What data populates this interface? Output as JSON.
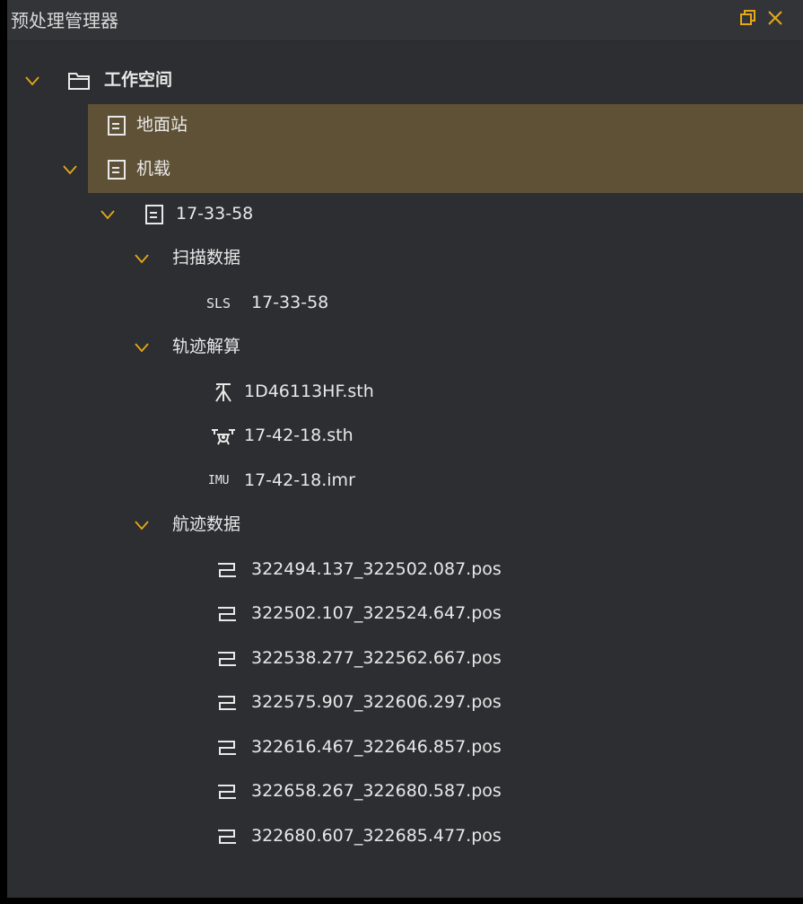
{
  "panel": {
    "title": "预处理管理器",
    "accent_color": "#e6a817",
    "selection_color": "#5f5136",
    "float_icon": "restore-window-icon",
    "close_icon": "close-icon"
  },
  "tree": {
    "root": {
      "label": "工作空间",
      "icon": "folder-icon",
      "expanded": true
    },
    "ground_station": {
      "label": "地面站",
      "icon": "document-icon",
      "selected": true
    },
    "airborne": {
      "label": "机载",
      "icon": "document-icon",
      "expanded": true,
      "selected": true
    },
    "session": {
      "label": "17-33-58",
      "icon": "document-icon",
      "expanded": true
    },
    "scan_data": {
      "label": "扫描数据",
      "expanded": true,
      "items": [
        {
          "icon_text": "SLS",
          "label": "17-33-58"
        }
      ]
    },
    "trajectory_solve": {
      "label": "轨迹解算",
      "expanded": true,
      "items": [
        {
          "icon": "base-station-icon",
          "label": "1D46113HF.sth"
        },
        {
          "icon": "drone-icon",
          "label": "17-42-18.sth"
        },
        {
          "icon_text": "IMU",
          "label": "17-42-18.imr"
        }
      ]
    },
    "flight_data": {
      "label": "航迹数据",
      "expanded": true,
      "items": [
        {
          "icon": "trajectory-icon",
          "label": "322494.137_322502.087.pos"
        },
        {
          "icon": "trajectory-icon",
          "label": "322502.107_322524.647.pos"
        },
        {
          "icon": "trajectory-icon",
          "label": "322538.277_322562.667.pos"
        },
        {
          "icon": "trajectory-icon",
          "label": "322575.907_322606.297.pos"
        },
        {
          "icon": "trajectory-icon",
          "label": "322616.467_322646.857.pos"
        },
        {
          "icon": "trajectory-icon",
          "label": "322658.267_322680.587.pos"
        },
        {
          "icon": "trajectory-icon",
          "label": "322680.607_322685.477.pos"
        }
      ]
    }
  }
}
